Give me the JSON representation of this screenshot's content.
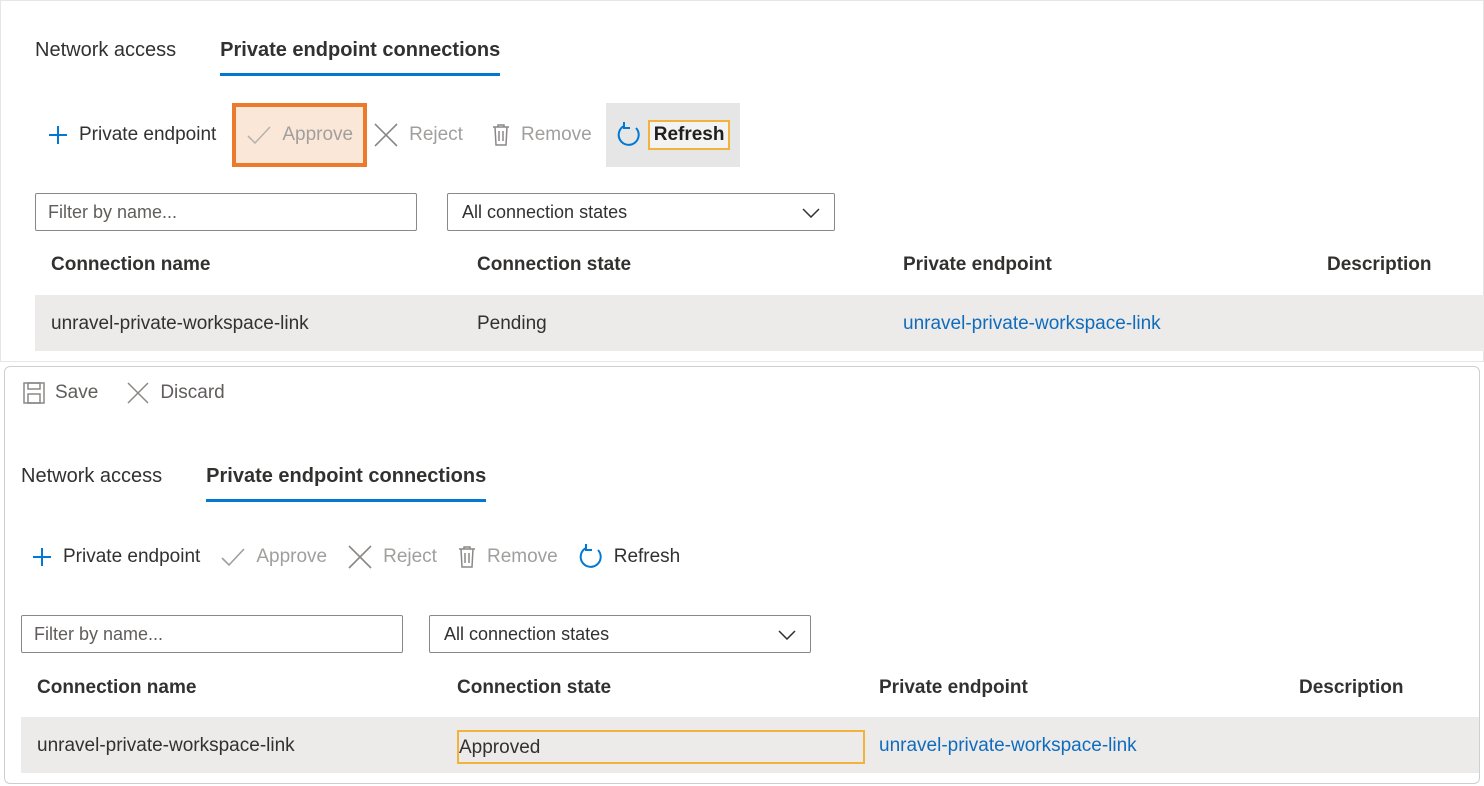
{
  "top": {
    "tabs": [
      {
        "label": "Network access",
        "active": false
      },
      {
        "label": "Private endpoint connections",
        "active": true
      }
    ],
    "toolbar": {
      "add_label": "Private endpoint",
      "approve_label": "Approve",
      "reject_label": "Reject",
      "remove_label": "Remove",
      "refresh_label": "Refresh"
    },
    "filter": {
      "placeholder": "Filter by name..."
    },
    "state_filter": {
      "selected": "All connection states"
    },
    "table": {
      "headers": [
        "Connection name",
        "Connection state",
        "Private endpoint",
        "Description"
      ],
      "rows": [
        {
          "name": "unravel-private-workspace-link",
          "state": "Pending",
          "endpoint": "unravel-private-workspace-link",
          "description": ""
        }
      ]
    }
  },
  "bottom": {
    "savebar": {
      "save_label": "Save",
      "discard_label": "Discard"
    },
    "tabs": [
      {
        "label": "Network access",
        "active": false
      },
      {
        "label": "Private endpoint connections",
        "active": true
      }
    ],
    "toolbar": {
      "add_label": "Private endpoint",
      "approve_label": "Approve",
      "reject_label": "Reject",
      "remove_label": "Remove",
      "refresh_label": "Refresh"
    },
    "filter": {
      "placeholder": "Filter by name..."
    },
    "state_filter": {
      "selected": "All connection states"
    },
    "table": {
      "headers": [
        "Connection name",
        "Connection state",
        "Private endpoint",
        "Description"
      ],
      "rows": [
        {
          "name": "unravel-private-workspace-link",
          "state": "Approved",
          "endpoint": "unravel-private-workspace-link",
          "description": ""
        }
      ]
    }
  },
  "colors": {
    "accent": "#0078d4",
    "link": "#0f6cbd",
    "approve_highlight": "#ec7a2c",
    "annotation_highlight": "#f2b33d"
  },
  "icons": [
    "plus-icon",
    "checkmark-icon",
    "close-icon",
    "trash-icon",
    "refresh-icon",
    "save-icon",
    "chevron-down-icon"
  ]
}
